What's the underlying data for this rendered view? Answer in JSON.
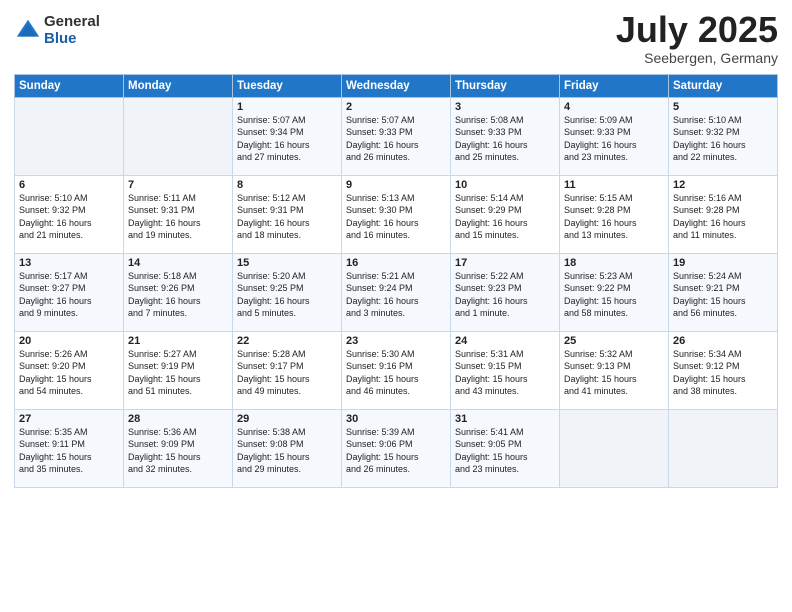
{
  "logo": {
    "general": "General",
    "blue": "Blue"
  },
  "title": "July 2025",
  "location": "Seebergen, Germany",
  "days_of_week": [
    "Sunday",
    "Monday",
    "Tuesday",
    "Wednesday",
    "Thursday",
    "Friday",
    "Saturday"
  ],
  "weeks": [
    [
      {
        "day": "",
        "info": ""
      },
      {
        "day": "",
        "info": ""
      },
      {
        "day": "1",
        "info": "Sunrise: 5:07 AM\nSunset: 9:34 PM\nDaylight: 16 hours\nand 27 minutes."
      },
      {
        "day": "2",
        "info": "Sunrise: 5:07 AM\nSunset: 9:33 PM\nDaylight: 16 hours\nand 26 minutes."
      },
      {
        "day": "3",
        "info": "Sunrise: 5:08 AM\nSunset: 9:33 PM\nDaylight: 16 hours\nand 25 minutes."
      },
      {
        "day": "4",
        "info": "Sunrise: 5:09 AM\nSunset: 9:33 PM\nDaylight: 16 hours\nand 23 minutes."
      },
      {
        "day": "5",
        "info": "Sunrise: 5:10 AM\nSunset: 9:32 PM\nDaylight: 16 hours\nand 22 minutes."
      }
    ],
    [
      {
        "day": "6",
        "info": "Sunrise: 5:10 AM\nSunset: 9:32 PM\nDaylight: 16 hours\nand 21 minutes."
      },
      {
        "day": "7",
        "info": "Sunrise: 5:11 AM\nSunset: 9:31 PM\nDaylight: 16 hours\nand 19 minutes."
      },
      {
        "day": "8",
        "info": "Sunrise: 5:12 AM\nSunset: 9:31 PM\nDaylight: 16 hours\nand 18 minutes."
      },
      {
        "day": "9",
        "info": "Sunrise: 5:13 AM\nSunset: 9:30 PM\nDaylight: 16 hours\nand 16 minutes."
      },
      {
        "day": "10",
        "info": "Sunrise: 5:14 AM\nSunset: 9:29 PM\nDaylight: 16 hours\nand 15 minutes."
      },
      {
        "day": "11",
        "info": "Sunrise: 5:15 AM\nSunset: 9:28 PM\nDaylight: 16 hours\nand 13 minutes."
      },
      {
        "day": "12",
        "info": "Sunrise: 5:16 AM\nSunset: 9:28 PM\nDaylight: 16 hours\nand 11 minutes."
      }
    ],
    [
      {
        "day": "13",
        "info": "Sunrise: 5:17 AM\nSunset: 9:27 PM\nDaylight: 16 hours\nand 9 minutes."
      },
      {
        "day": "14",
        "info": "Sunrise: 5:18 AM\nSunset: 9:26 PM\nDaylight: 16 hours\nand 7 minutes."
      },
      {
        "day": "15",
        "info": "Sunrise: 5:20 AM\nSunset: 9:25 PM\nDaylight: 16 hours\nand 5 minutes."
      },
      {
        "day": "16",
        "info": "Sunrise: 5:21 AM\nSunset: 9:24 PM\nDaylight: 16 hours\nand 3 minutes."
      },
      {
        "day": "17",
        "info": "Sunrise: 5:22 AM\nSunset: 9:23 PM\nDaylight: 16 hours\nand 1 minute."
      },
      {
        "day": "18",
        "info": "Sunrise: 5:23 AM\nSunset: 9:22 PM\nDaylight: 15 hours\nand 58 minutes."
      },
      {
        "day": "19",
        "info": "Sunrise: 5:24 AM\nSunset: 9:21 PM\nDaylight: 15 hours\nand 56 minutes."
      }
    ],
    [
      {
        "day": "20",
        "info": "Sunrise: 5:26 AM\nSunset: 9:20 PM\nDaylight: 15 hours\nand 54 minutes."
      },
      {
        "day": "21",
        "info": "Sunrise: 5:27 AM\nSunset: 9:19 PM\nDaylight: 15 hours\nand 51 minutes."
      },
      {
        "day": "22",
        "info": "Sunrise: 5:28 AM\nSunset: 9:17 PM\nDaylight: 15 hours\nand 49 minutes."
      },
      {
        "day": "23",
        "info": "Sunrise: 5:30 AM\nSunset: 9:16 PM\nDaylight: 15 hours\nand 46 minutes."
      },
      {
        "day": "24",
        "info": "Sunrise: 5:31 AM\nSunset: 9:15 PM\nDaylight: 15 hours\nand 43 minutes."
      },
      {
        "day": "25",
        "info": "Sunrise: 5:32 AM\nSunset: 9:13 PM\nDaylight: 15 hours\nand 41 minutes."
      },
      {
        "day": "26",
        "info": "Sunrise: 5:34 AM\nSunset: 9:12 PM\nDaylight: 15 hours\nand 38 minutes."
      }
    ],
    [
      {
        "day": "27",
        "info": "Sunrise: 5:35 AM\nSunset: 9:11 PM\nDaylight: 15 hours\nand 35 minutes."
      },
      {
        "day": "28",
        "info": "Sunrise: 5:36 AM\nSunset: 9:09 PM\nDaylight: 15 hours\nand 32 minutes."
      },
      {
        "day": "29",
        "info": "Sunrise: 5:38 AM\nSunset: 9:08 PM\nDaylight: 15 hours\nand 29 minutes."
      },
      {
        "day": "30",
        "info": "Sunrise: 5:39 AM\nSunset: 9:06 PM\nDaylight: 15 hours\nand 26 minutes."
      },
      {
        "day": "31",
        "info": "Sunrise: 5:41 AM\nSunset: 9:05 PM\nDaylight: 15 hours\nand 23 minutes."
      },
      {
        "day": "",
        "info": ""
      },
      {
        "day": "",
        "info": ""
      }
    ]
  ]
}
